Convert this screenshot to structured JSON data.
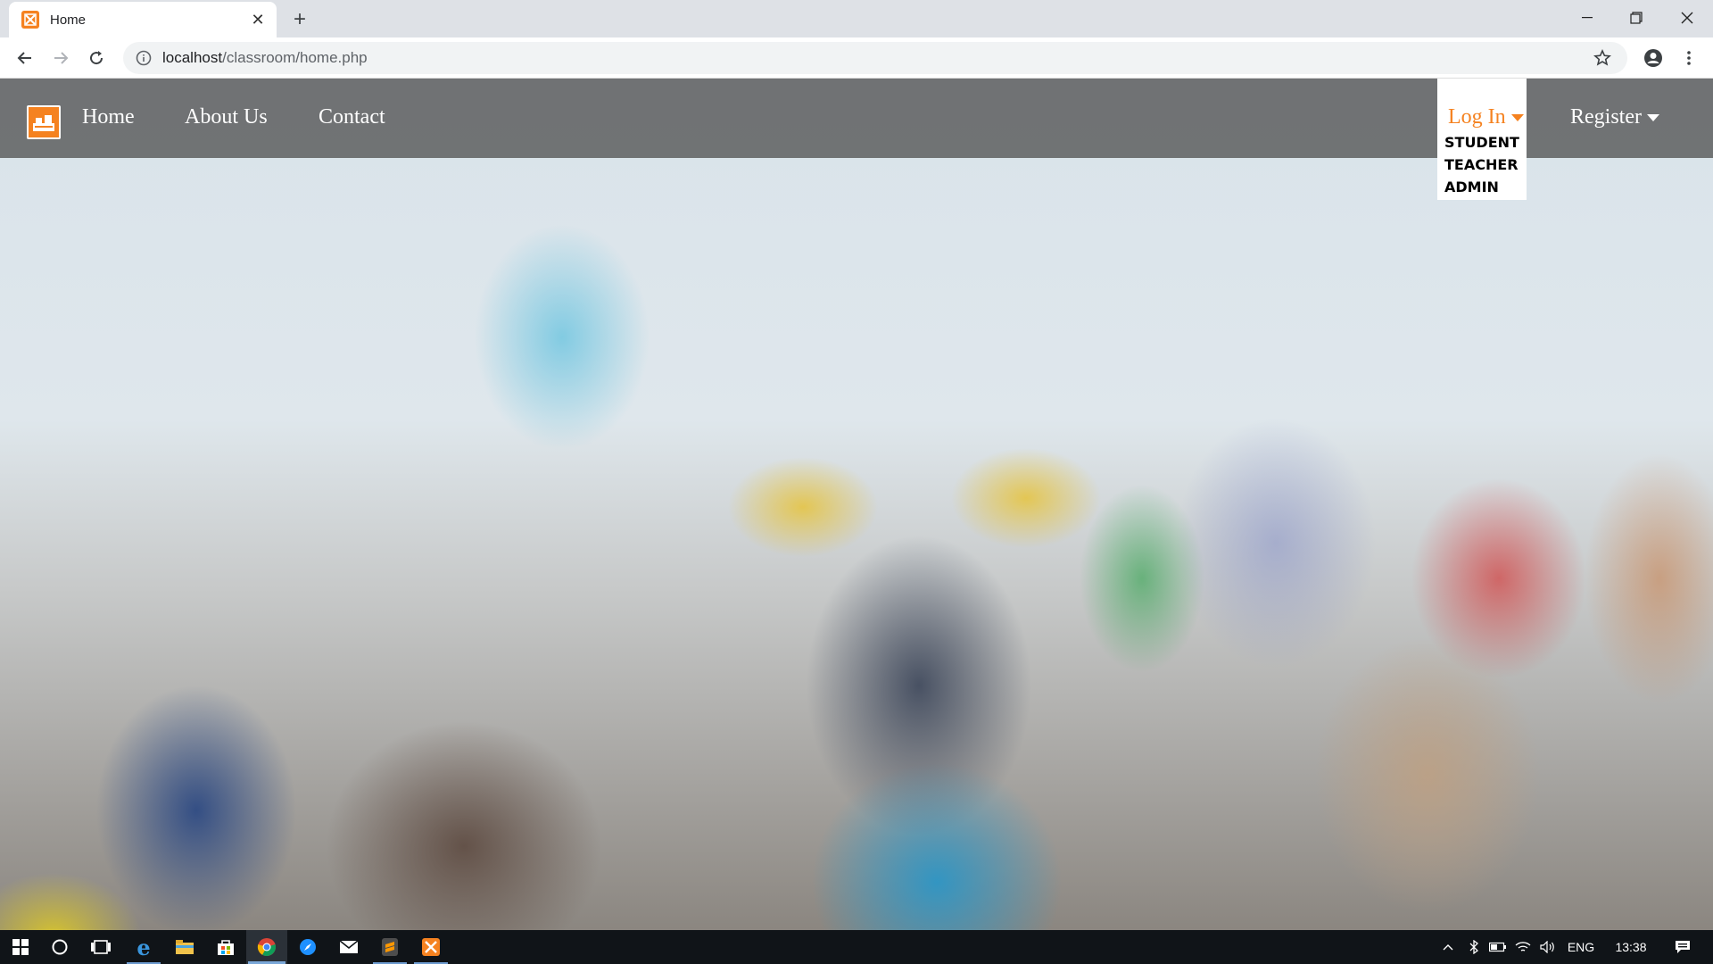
{
  "browser": {
    "tab": {
      "title": "Home",
      "favicon": "xampp-icon"
    },
    "url": {
      "host": "localhost",
      "path": "/classroom/home.php"
    },
    "window_controls": [
      "minimize",
      "restore",
      "close"
    ]
  },
  "site": {
    "brand_color": "#f58220",
    "nav": {
      "home": "Home",
      "about": "About Us",
      "contact": "Contact"
    },
    "login": {
      "label": "Log In",
      "options": [
        "STUDENT",
        "TEACHER",
        "ADMIN"
      ]
    },
    "register": {
      "label": "Register"
    },
    "hero_image": "classroom-lecture-photo"
  },
  "taskbar": {
    "apps": [
      "start-icon",
      "cortana-icon",
      "task-view-icon",
      "edge-icon",
      "file-explorer-icon",
      "store-icon",
      "chrome-icon",
      "safari-icon",
      "mail-icon",
      "sublime-icon",
      "xampp-icon"
    ],
    "tray": {
      "language": "ENG",
      "time": "13:38"
    }
  }
}
